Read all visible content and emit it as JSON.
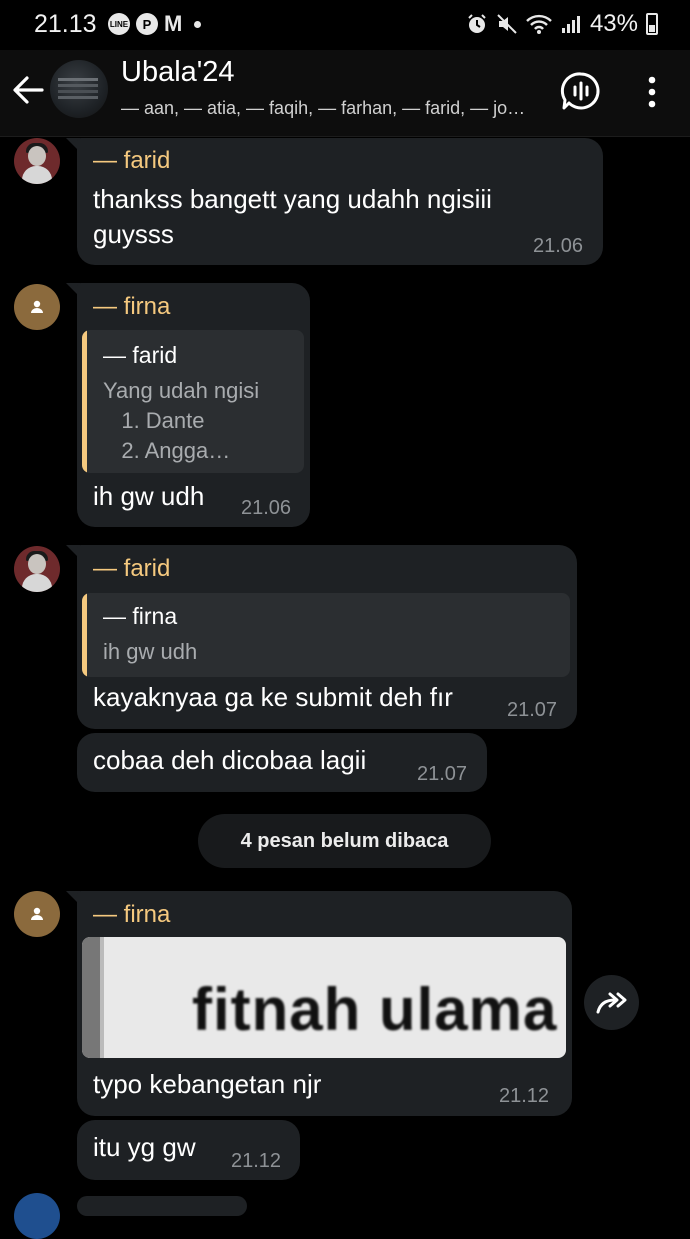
{
  "status_bar": {
    "time": "21.13",
    "battery": "43%",
    "left_icons": [
      "line-icon",
      "pinterest-icon",
      "gmail-icon",
      "dot-icon"
    ],
    "line_label": "LINE",
    "pinterest_label": "P",
    "gmail_label": "M",
    "right_icons": [
      "alarm-icon",
      "mute-icon",
      "wifi-icon",
      "signal-icon",
      "battery-icon"
    ]
  },
  "header": {
    "title": "Ubala'24",
    "subtitle": "— aan, — atia, — faqih, — farhan, — farid, — jo…"
  },
  "messages": [
    {
      "sender": "— farid",
      "text": "thankss bangett yang udahh ngisiii guysss",
      "time": "21.06"
    },
    {
      "sender": "— firna",
      "quote": {
        "sender": "— farid",
        "text_lines": [
          "Yang udah ngisi",
          "   1. Dante",
          "   2. Angga…"
        ]
      },
      "text": "ih gw udh",
      "time": "21.06"
    },
    {
      "sender": "— farid",
      "quote": {
        "sender": "— firna",
        "text": "ih gw udh"
      },
      "text": "kayaknyaa ga ke submit deh fır",
      "time": "21.07"
    },
    {
      "text": "cobaa deh dicobaa lagii",
      "time": "21.07"
    }
  ],
  "unread_divider": "4 pesan belum dibaca",
  "messages_after": [
    {
      "sender": "— firna",
      "image_text": "fitnah ulama",
      "text": "typo kebangetan njr",
      "time": "21.12"
    },
    {
      "text": "itu yg gw",
      "time": "21.12"
    }
  ],
  "colors": {
    "background": "#000000",
    "bubble": "#1e2124",
    "sender_name": "#f5c97f",
    "timestamp": "#8e9296",
    "quote_bar": "#f5c97f"
  }
}
